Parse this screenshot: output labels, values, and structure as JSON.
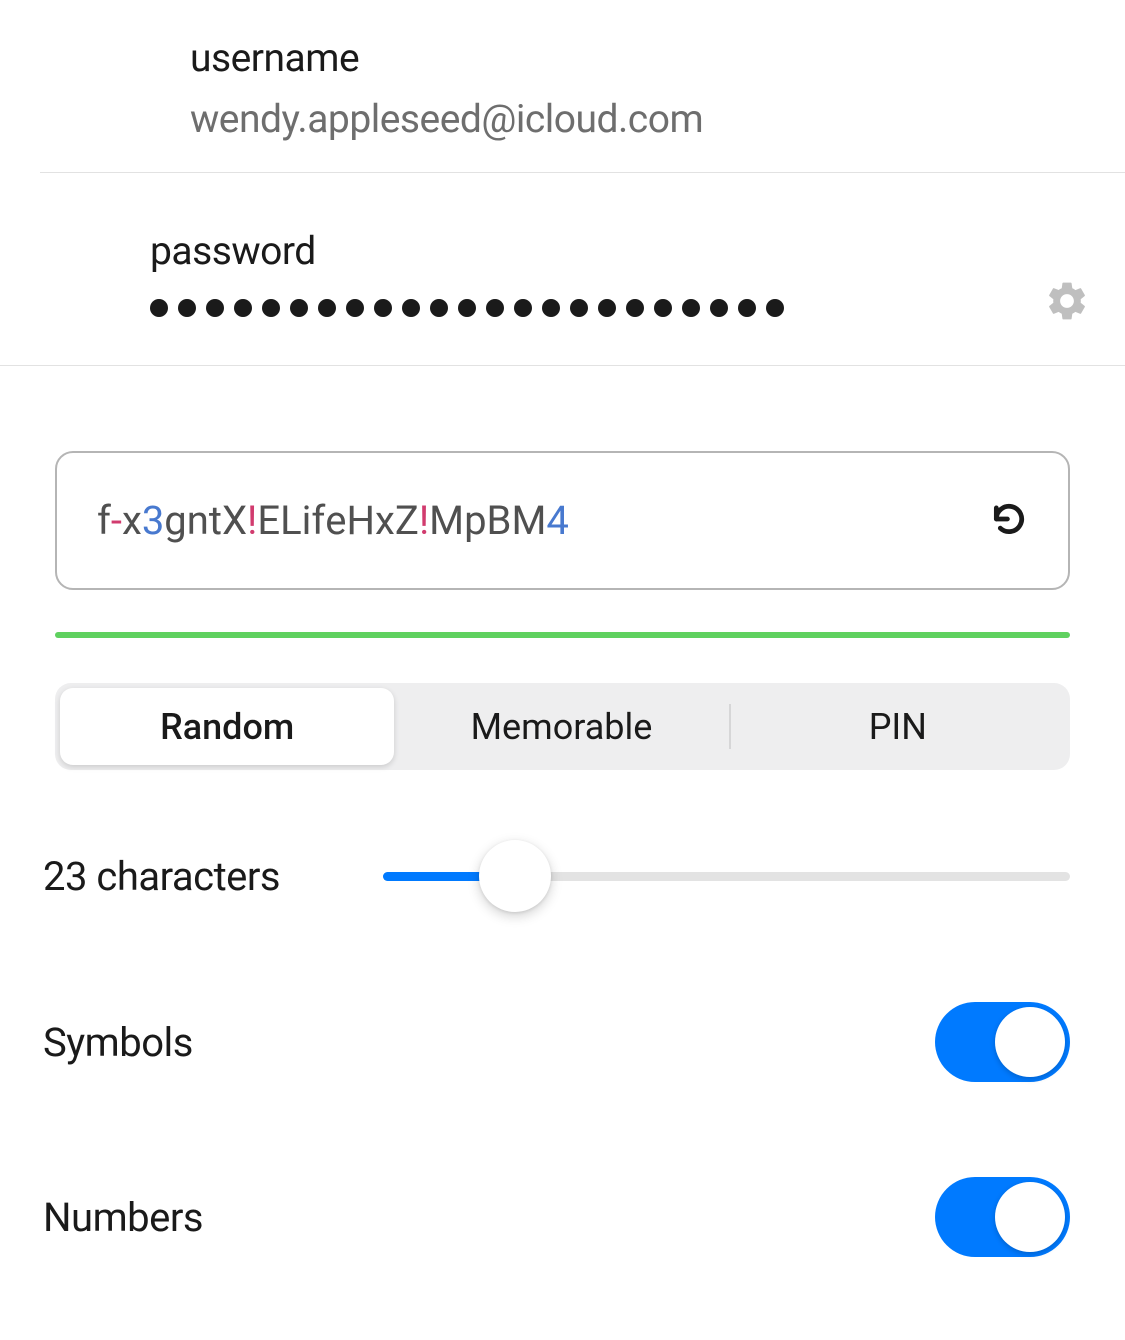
{
  "credentials": {
    "username_label": "username",
    "username_value": "wendy.appleseed@icloud.com",
    "password_label": "password",
    "password_dot_count": 23
  },
  "generator": {
    "password_chars": [
      {
        "c": "f",
        "t": "letter"
      },
      {
        "c": "-",
        "t": "symbol"
      },
      {
        "c": "x",
        "t": "letter"
      },
      {
        "c": "3",
        "t": "number"
      },
      {
        "c": "g",
        "t": "letter"
      },
      {
        "c": "n",
        "t": "letter"
      },
      {
        "c": "t",
        "t": "letter"
      },
      {
        "c": "X",
        "t": "letter"
      },
      {
        "c": "!",
        "t": "symbol"
      },
      {
        "c": "E",
        "t": "letter"
      },
      {
        "c": "L",
        "t": "letter"
      },
      {
        "c": "i",
        "t": "letter"
      },
      {
        "c": "f",
        "t": "letter"
      },
      {
        "c": "e",
        "t": "letter"
      },
      {
        "c": "H",
        "t": "letter"
      },
      {
        "c": "x",
        "t": "letter"
      },
      {
        "c": "Z",
        "t": "letter"
      },
      {
        "c": "!",
        "t": "symbol"
      },
      {
        "c": "M",
        "t": "letter"
      },
      {
        "c": "p",
        "t": "letter"
      },
      {
        "c": "B",
        "t": "letter"
      },
      {
        "c": "M",
        "t": "letter"
      },
      {
        "c": "4",
        "t": "number"
      }
    ],
    "strength_color": "#5fd15f",
    "segments": {
      "random": "Random",
      "memorable": "Memorable",
      "pin": "PIN",
      "active": "random"
    },
    "length_label": "23 characters",
    "length_value": 23,
    "slider_percent": 14,
    "options": {
      "symbols_label": "Symbols",
      "symbols_on": true,
      "numbers_label": "Numbers",
      "numbers_on": true
    }
  },
  "icons": {
    "gear": "gear-icon",
    "refresh": "refresh-icon"
  }
}
